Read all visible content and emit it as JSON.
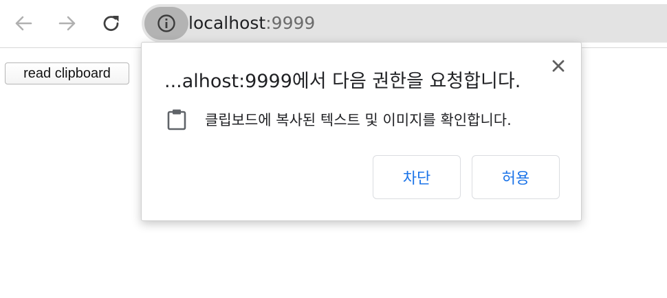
{
  "toolbar": {
    "back_icon": "arrow-left-icon",
    "forward_icon": "arrow-right-icon",
    "reload_icon": "reload-icon",
    "site_info_icon": "info-icon"
  },
  "address_bar": {
    "host": "localhost",
    "port": ":9999"
  },
  "page": {
    "read_button_label": "read clipboard"
  },
  "permission_popup": {
    "title": "...alhost:9999에서 다음 권한을 요청합니다.",
    "close_icon": "close-icon",
    "permission_icon": "clipboard-icon",
    "permission_text": "클립보드에 복사된 텍스트 및 이미지를 확인합니다.",
    "block_label": "차단",
    "allow_label": "허용"
  },
  "colors": {
    "button_text": "#1a73e8",
    "toolbar_icon_disabled": "#9aa0a6",
    "toolbar_icon": "#5f6368"
  }
}
